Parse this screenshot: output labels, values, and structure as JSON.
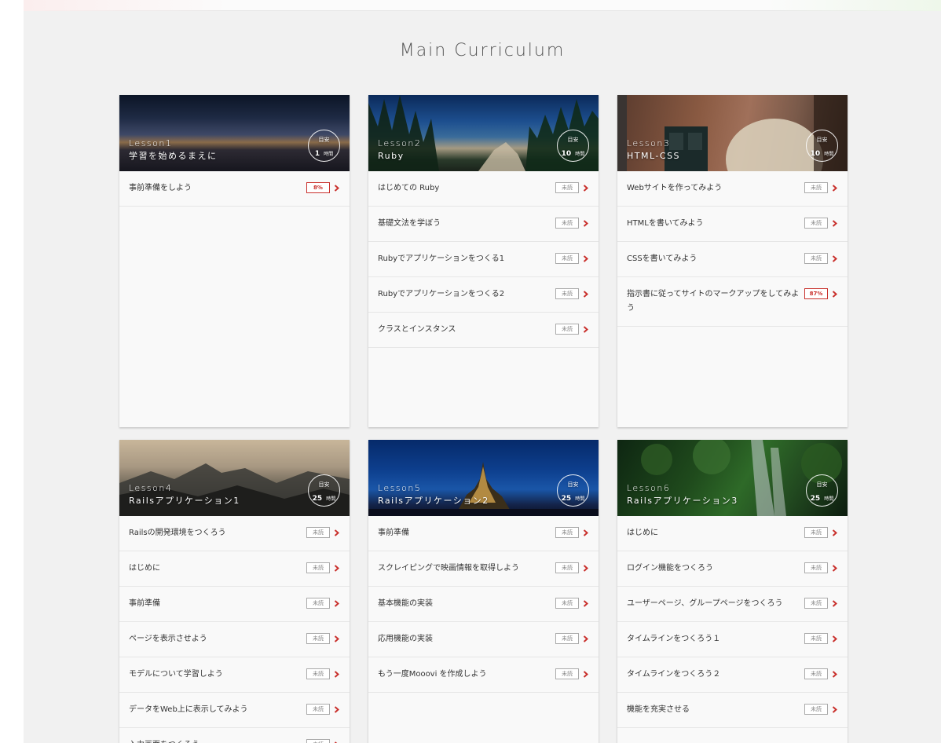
{
  "page": {
    "section_title": "Main Curriculum",
    "accent_color": "#c9302c"
  },
  "cards": [
    {
      "lesson": "Lesson1",
      "name": "学習を始めるまえに",
      "badge_label": "目安",
      "badge_value": "1",
      "badge_unit": "時間",
      "items": [
        {
          "label": "事前準備をしよう",
          "status": "8%"
        }
      ]
    },
    {
      "lesson": "Lesson2",
      "name": "Ruby",
      "badge_label": "目安",
      "badge_value": "10",
      "badge_unit": "時間",
      "items": [
        {
          "label": "はじめての Ruby",
          "status": "未読"
        },
        {
          "label": "基礎文法を学ぼう",
          "status": "未読"
        },
        {
          "label": "Rubyでアプリケーションをつくる1",
          "status": "未読"
        },
        {
          "label": "Rubyでアプリケーションをつくる2",
          "status": "未読"
        },
        {
          "label": "クラスとインスタンス",
          "status": "未読"
        }
      ]
    },
    {
      "lesson": "Lesson3",
      "name": "HTML-CSS",
      "badge_label": "目安",
      "badge_value": "10",
      "badge_unit": "時間",
      "items": [
        {
          "label": "Webサイトを作ってみよう",
          "status": "未読"
        },
        {
          "label": "HTMLを書いてみよう",
          "status": "未読"
        },
        {
          "label": "CSSを書いてみよう",
          "status": "未読"
        },
        {
          "label": "指示書に従ってサイトのマークアップをしてみよう",
          "status": "87%"
        }
      ]
    },
    {
      "lesson": "Lesson4",
      "name": "Railsアプリケーション1",
      "badge_label": "目安",
      "badge_value": "25",
      "badge_unit": "時間",
      "items": [
        {
          "label": "Railsの開発環境をつくろう",
          "status": "未読"
        },
        {
          "label": "はじめに",
          "status": "未読"
        },
        {
          "label": "事前準備",
          "status": "未読"
        },
        {
          "label": "ページを表示させよう",
          "status": "未読"
        },
        {
          "label": "モデルについて学習しよう",
          "status": "未読"
        },
        {
          "label": "データをWeb上に表示してみよう",
          "status": "未読"
        },
        {
          "label": "入力画面をつくろう",
          "status": "未読"
        }
      ]
    },
    {
      "lesson": "Lesson5",
      "name": "Railsアプリケーション2",
      "badge_label": "目安",
      "badge_value": "25",
      "badge_unit": "時間",
      "items": [
        {
          "label": "事前準備",
          "status": "未読"
        },
        {
          "label": "スクレイピングで映画情報を取得しよう",
          "status": "未読"
        },
        {
          "label": "基本機能の実装",
          "status": "未読"
        },
        {
          "label": "応用機能の実装",
          "status": "未読"
        },
        {
          "label": "もう一度Mooovi を作成しよう",
          "status": "未読"
        }
      ]
    },
    {
      "lesson": "Lesson6",
      "name": "Railsアプリケーション3",
      "badge_label": "目安",
      "badge_value": "25",
      "badge_unit": "時間",
      "items": [
        {
          "label": "はじめに",
          "status": "未読"
        },
        {
          "label": "ログイン機能をつくろう",
          "status": "未読"
        },
        {
          "label": "ユーザーページ、グループページをつくろう",
          "status": "未読"
        },
        {
          "label": "タイムラインをつくろう１",
          "status": "未読"
        },
        {
          "label": "タイムラインをつくろう２",
          "status": "未読"
        },
        {
          "label": "機能を充実させる",
          "status": "未読"
        }
      ]
    }
  ]
}
